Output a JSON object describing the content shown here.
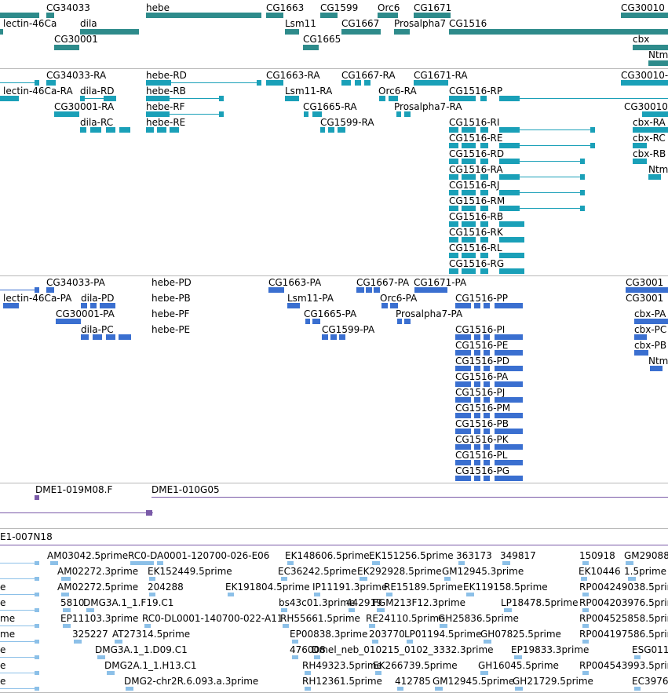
{
  "colors": {
    "gene": "#2e8b8b",
    "transcript": "#1aa0b8",
    "protein": "#3a6fd0",
    "clone": "#7a5aa8",
    "est": "#8cc0e8",
    "separator": "#b8b8b8"
  },
  "tracks": {
    "genes": {
      "labels": [
        "CG34033",
        "hebe",
        "CG1663",
        "CG1599",
        "Orc6",
        "CG1671",
        "CG30010",
        "lectin-46Ca",
        "dila",
        "Lsm11",
        "CG1667",
        "Prosalpha7",
        "CG1516",
        "CG30001",
        "CG1665",
        "cbx",
        "Ntmt"
      ]
    },
    "transcripts": {
      "labels": [
        "CG34033-RA",
        "hebe-RD",
        "CG1663-RA",
        "CG1667-RA",
        "CG1671-RA",
        "CG30010-",
        "lectin-46Ca-RA",
        "dila-RD",
        "hebe-RB",
        "Lsm11-RA",
        "Orc6-RA",
        "CG1516-RP",
        "CG30001-RA",
        "hebe-RF",
        "CG1665-RA",
        "Prosalpha7-RA",
        "CG30010",
        "dila-RC",
        "hebe-RE",
        "CG1599-RA",
        "CG1516-RI",
        "cbx-RA",
        "CG1516-RE",
        "cbx-RC",
        "CG1516-RD",
        "cbx-RB",
        "CG1516-RA",
        "Ntmt",
        "CG1516-RJ",
        "CG1516-RM",
        "CG1516-RB",
        "CG1516-RK",
        "CG1516-RL",
        "CG1516-RG"
      ]
    },
    "proteins": {
      "labels": [
        "CG34033-PA",
        "hebe-PD",
        "CG1663-PA",
        "CG1667-PA",
        "CG1671-PA",
        "CG3001",
        "lectin-46Ca-PA",
        "dila-PD",
        "hebe-PB",
        "Lsm11-PA",
        "Orc6-PA",
        "CG1516-PP",
        "CG3001",
        "CG30001-PA",
        "hebe-PF",
        "CG1665-PA",
        "Prosalpha7-PA",
        "cbx-PA",
        "dila-PC",
        "hebe-PE",
        "CG1599-PA",
        "CG1516-PI",
        "cbx-PC",
        "CG1516-PE",
        "cbx-PB",
        "CG1516-PD",
        "Ntm",
        "CG1516-PA",
        "CG1516-PJ",
        "CG1516-PM",
        "CG1516-PB",
        "CG1516-PK",
        "CG1516-PL",
        "CG1516-PG"
      ]
    },
    "clones": {
      "labels": [
        "DME1-019M08.F",
        "DME1-010G05",
        "E1-007N18"
      ]
    },
    "ests": {
      "labels": [
        "AM03042.5prime",
        "RC0-DA0001-120700-026-E06",
        "EK148606.5prime",
        "EK151256.5prime",
        "363173",
        "349817",
        "150918",
        "GM29088",
        "AM02272.3prime",
        "EK152449.5prime",
        "EC36242.5prime",
        "EK292928.5prime",
        "GM12945.3prime",
        "EK10446",
        "1.5prime",
        "e",
        "AM02272.5prime",
        "204288",
        "EK191804.5prime",
        "IP11191.3prime",
        "RE15189.5prime",
        "EK119158.5prime",
        "RP004249038.5prime",
        "e",
        "5810",
        "DMG3A.1_1.F19.C1",
        "bs43c01.3prime",
        "442919",
        "FGM213F12.3prime",
        "LP18478.5prime",
        "RP004203976.5prime",
        "me",
        "EP11103.3prime",
        "RC0-DL0001-140700-022-A11",
        "RH55661.5prime",
        "RE24110.5prime",
        "GH25836.5prime",
        "RP004525858.5prime",
        "me",
        "325227",
        "AT27314.5prime",
        "EP00838.3prime",
        "203770",
        "LP01194.5prime",
        "GH07825.5prime",
        "RP004197586.5prime",
        "e",
        "DMG3A.1_1.D09.C1",
        "476008",
        "Dmel_neb_010215_0102_3332.3prime",
        "EP19833.3prime",
        "ESG011",
        "e",
        "DMG2A.1_1.H13.C1",
        "RH49323.5prime",
        "EK266739.5prime",
        "GH16045.5prime",
        "RP004543993.5prime",
        "e",
        "DMG2-chr2R.6.093.a.3prime",
        "RH12361.5prime",
        "412785",
        "GM12945.5prime",
        "GH21729.5prime",
        "EC3976"
      ]
    }
  }
}
